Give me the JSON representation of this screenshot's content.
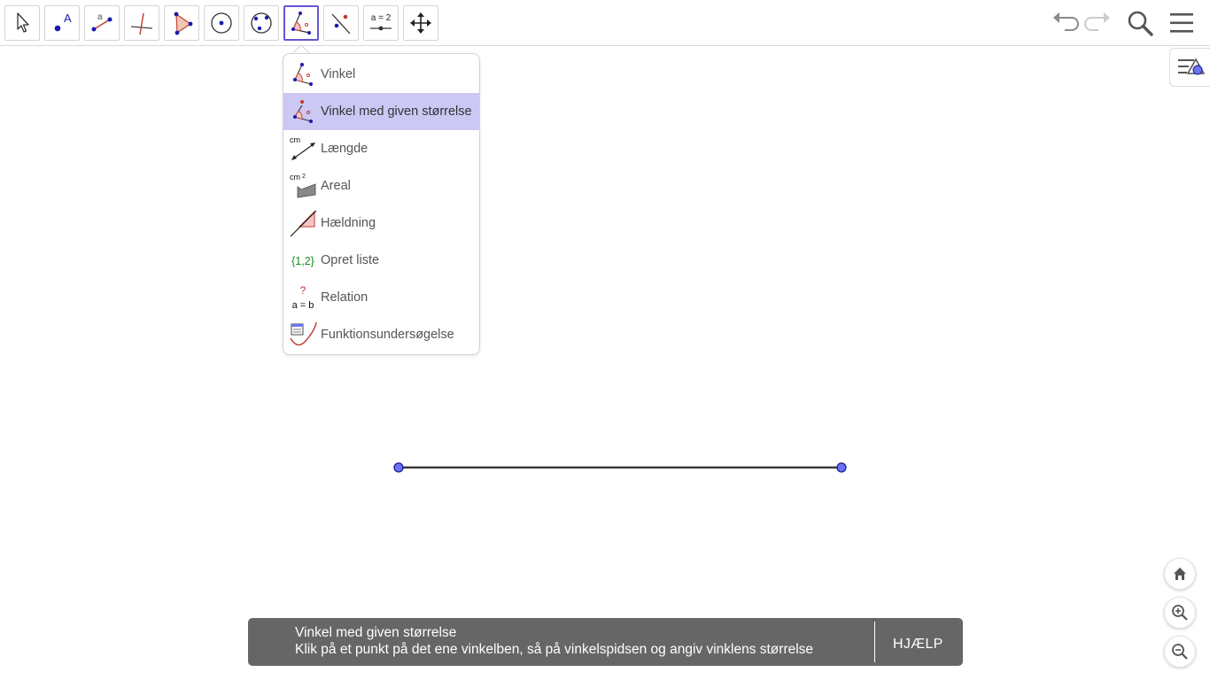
{
  "toolbar": {
    "tools": [
      {
        "name": "move",
        "icon": "arrow-pointer-icon",
        "active": false
      },
      {
        "name": "point",
        "icon": "point-icon",
        "active": false
      },
      {
        "name": "segment",
        "icon": "segment-icon",
        "active": false
      },
      {
        "name": "perpendicular",
        "icon": "perpendicular-line-icon",
        "active": false
      },
      {
        "name": "polygon",
        "icon": "polygon-icon",
        "active": false
      },
      {
        "name": "circle-center-point",
        "icon": "circle-center-icon",
        "active": false
      },
      {
        "name": "circle-three-points",
        "icon": "circle-three-points-icon",
        "active": false
      },
      {
        "name": "angle",
        "icon": "angle-icon",
        "active": true
      },
      {
        "name": "reflect",
        "icon": "reflect-icon",
        "active": false
      },
      {
        "name": "slider",
        "icon": "slider-icon",
        "active": false
      },
      {
        "name": "move-graphics",
        "icon": "move-view-icon",
        "active": false
      }
    ],
    "slider_label": "a = 2",
    "point_label": "A",
    "segment_label": "a",
    "right_icons": [
      "undo-icon",
      "redo-icon",
      "search-icon",
      "menu-icon"
    ]
  },
  "dropdown": {
    "items": [
      {
        "label": "Vinkel",
        "icon": "angle-icon",
        "selected": false
      },
      {
        "label": "Vinkel med given størrelse",
        "icon": "angle-given-size-icon",
        "selected": true
      },
      {
        "label": "Længde",
        "icon": "distance-icon",
        "selected": false
      },
      {
        "label": "Areal",
        "icon": "area-icon",
        "selected": false
      },
      {
        "label": "Hældning",
        "icon": "slope-icon",
        "selected": false
      },
      {
        "label": "Opret liste",
        "icon": "list-icon",
        "selected": false
      },
      {
        "label": "Relation",
        "icon": "relation-icon",
        "selected": false
      },
      {
        "label": "Funktionsundersøgelse",
        "icon": "function-inspector-icon",
        "selected": false
      }
    ],
    "icon_texts": {
      "distance_unit": "cm",
      "area_unit": "cm",
      "area_exp": "2",
      "list_text": "{1,2}",
      "relation_q": "?",
      "relation_eq": "a = b"
    }
  },
  "side": {
    "style_bar_icon": "style-bar-icon"
  },
  "zoom": {
    "home_icon": "home-icon",
    "zoom_in_icon": "zoom-in-icon",
    "zoom_out_icon": "zoom-out-icon"
  },
  "colors": {
    "accent": "#6557d2",
    "point_fill": "#6b74f0",
    "point_stroke": "#1a1a99",
    "highlight": "#cbc8f4",
    "tooltip_bg": "#666666"
  },
  "tooltip": {
    "title": "Vinkel med given størrelse",
    "description": "Klik på et punkt på det ene vinkelben, så på vinkelspidsen og angiv vinklens størrelse",
    "help_label": "HJÆLP"
  }
}
